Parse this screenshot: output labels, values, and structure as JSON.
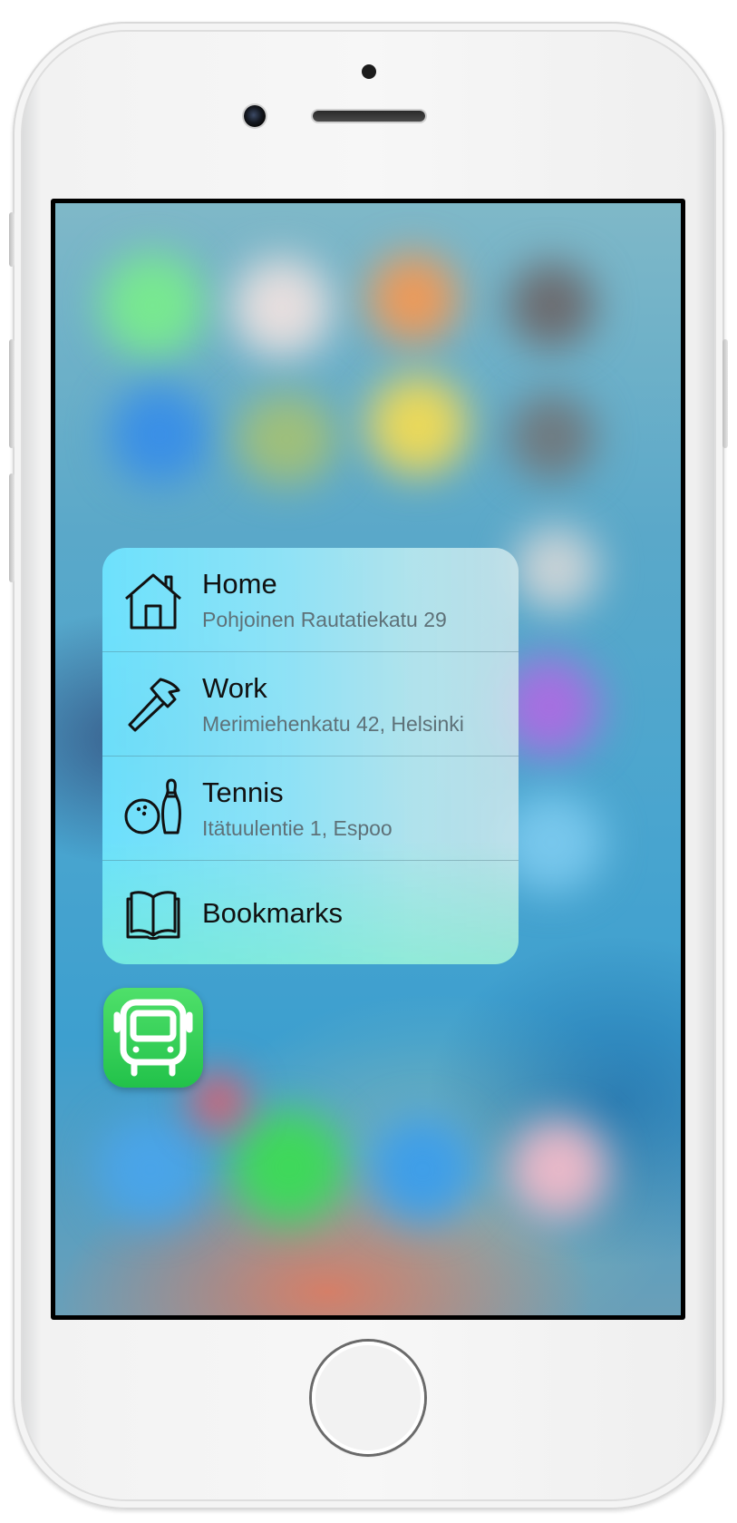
{
  "device": "iPhone",
  "quick_actions": [
    {
      "title": "Home",
      "subtitle": "Pohjoinen Rautatiekatu 29",
      "icon": "house-icon"
    },
    {
      "title": "Work",
      "subtitle": "Merimiehenkatu 42, Helsinki",
      "icon": "hammer-icon"
    },
    {
      "title": "Tennis",
      "subtitle": "Itätuulentie 1, Espoo",
      "icon": "bowling-icon"
    },
    {
      "title": "Bookmarks",
      "subtitle": "",
      "icon": "book-icon"
    }
  ],
  "app": {
    "icon": "bus-icon",
    "color": "#2fcf55"
  },
  "colors": {
    "menu_tint": "#8ee6fb",
    "title_text": "#111111",
    "subtitle_text": "#5e7178"
  }
}
